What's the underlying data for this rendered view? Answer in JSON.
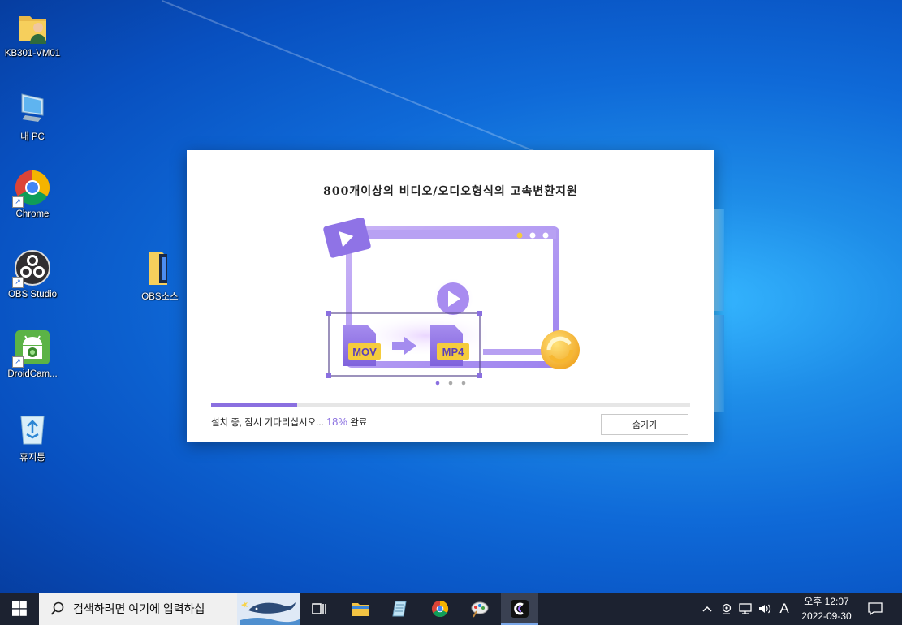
{
  "desktop": {
    "icons": [
      {
        "label": "KB301-VM01",
        "icon": "user-folder-icon"
      },
      {
        "label": "내 PC",
        "icon": "computer-icon"
      },
      {
        "label": "Chrome",
        "icon": "chrome-icon"
      },
      {
        "label": "OBS Studio",
        "icon": "obs-icon"
      },
      {
        "label": "DroidCam...",
        "icon": "droidcam-icon"
      },
      {
        "label": "휴지통",
        "icon": "recycle-bin-icon"
      },
      {
        "label": "OBS소스",
        "icon": "folder-icon"
      }
    ]
  },
  "dialog": {
    "headline": "800개이상의 비디오/오디오형식의 고속변환지원",
    "illustration": {
      "source_format": "MOV",
      "target_format": "MP4",
      "carousel_dots": 3,
      "active_dot": 0
    },
    "progress": 0.18,
    "status_prefix": "설치 중, 잠시 기다리십시오...",
    "status_percent": "18%",
    "status_suffix": "완료",
    "hide_button": "숨기기",
    "colors": {
      "accent": "#8a6fe0",
      "badge": "#f5cc3c"
    }
  },
  "taskbar": {
    "search_placeholder": "검색하려면 여기에 입력하십",
    "pinned": [
      "task-view-icon",
      "file-explorer-icon",
      "notepad-icon",
      "chrome-icon",
      "paint-icon",
      "converter-app-icon"
    ],
    "tray_ime": "A",
    "clock_time": "오후 12:07",
    "clock_date": "2022-09-30"
  }
}
